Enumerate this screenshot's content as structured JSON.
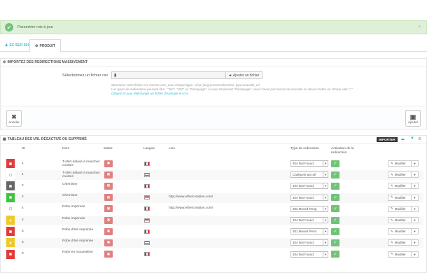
{
  "alert": {
    "message": "Paramètre mis à jour",
    "close": "×"
  },
  "tabs": [
    {
      "label": "EC SEO 301"
    },
    {
      "label": "PRODUIT"
    }
  ],
  "import_panel": {
    "title": "IMPORTEZ DES REDIRECTIONS MASSIVEMENT",
    "file_label": "Sélectionnez un fichier csv",
    "add_file_label": "Ajouter un fichier",
    "help_line_1": "Structurez votre fichier csv comme ceci, pour chaque ligne : id;id_lang;enumcredirection_type;nouvelle_url",
    "help_line_2": "Les types de redirections peuvent être : \"301\", \"302\" ou \"homepage\", si vous choisissez \"homepage\", vous n'avez pas besoin de nouvelle url devez mettre un champ vide \";;\"",
    "help_line_3": "Cliquez ici pour télécharger un fichier d'exemple en csv",
    "cancel_label": "Annuler",
    "add_label": "Ajouter"
  },
  "table_panel": {
    "title": "TABLEAU DES URL DÉSACTIVÉ OU SUPPRIMÉ",
    "import_button": "IMPORTER",
    "headers": {
      "id": "ID",
      "name": "Nom",
      "status": "Statut",
      "language": "Langue",
      "link": "Lien",
      "redirect_type": "Type de redirection",
      "activation": "Activation de la redirection"
    },
    "modify_label": "Modifier",
    "rows": [
      {
        "color": "#e13b3b",
        "id": "1",
        "name": "T-shirt délavé à manches courtes",
        "lang": "fr",
        "link": "",
        "type": "404 Not Found"
      },
      {
        "color": "#ffffff",
        "id": "1",
        "name": "T-shirt délavé à manches courtes",
        "lang": "us",
        "link": "",
        "type": "Catégorie par dé"
      },
      {
        "color": "#666666",
        "id": "2",
        "name": "Chemisier",
        "lang": "fr",
        "link": "",
        "type": "404 Not Found"
      },
      {
        "color": "#3cc43c",
        "id": "2",
        "name": "Chemisier",
        "lang": "us",
        "link": "http://www.ethercreation.com/",
        "type": "404 Not Found"
      },
      {
        "color": "#ffffff",
        "id": "4",
        "name": "Robe imprimée",
        "lang": "fr",
        "link": "http://www.ethercreation.com/",
        "type": "302 Moved Temp"
      },
      {
        "color": "#f0c929",
        "id": "4",
        "name": "Robe imprimée",
        "lang": "us",
        "link": "",
        "type": "404 Not Found"
      },
      {
        "color": "#e13b3b",
        "id": "5",
        "name": "Robe d'été imprimée",
        "lang": "fr",
        "link": "",
        "type": "301 Moved Perm"
      },
      {
        "color": "#f0c929",
        "id": "5",
        "name": "Robe d'été imprimée",
        "lang": "us",
        "link": "",
        "type": "404 Not Found"
      },
      {
        "color": "#e13b3b",
        "id": "9",
        "name": "Robe en mousseline",
        "lang": "fr",
        "link": "",
        "type": "404 Not Found"
      }
    ]
  }
}
